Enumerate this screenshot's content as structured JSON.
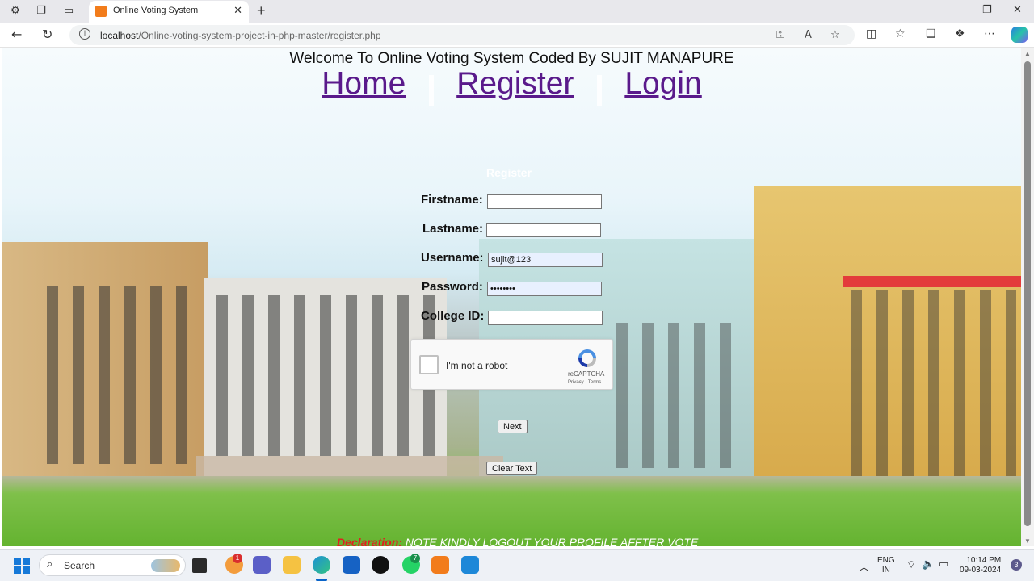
{
  "browser": {
    "tab_title": "Online Voting System",
    "url_host": "localhost",
    "url_path": "/Online-voting-system-project-in-php-master/register.php"
  },
  "page": {
    "welcome": "Welcome To Online Voting System Coded By SUJIT MANAPURE",
    "nav": {
      "home": "Home",
      "register": "Register",
      "login": "Login"
    },
    "form": {
      "title": "Register",
      "firstname_label": "Firstname:",
      "firstname_value": "",
      "lastname_label": "Lastname:",
      "lastname_value": "",
      "username_label": "Username:",
      "username_value": "sujit@123",
      "password_label": "Password:",
      "password_value": "••••••••",
      "college_label": "College ID:",
      "college_value": ""
    },
    "captcha": {
      "checkbox_label": "I'm not a robot",
      "brand": "reCAPTCHA",
      "links": "Privacy - Terms"
    },
    "buttons": {
      "next": "Next",
      "clear": "Clear Text"
    },
    "declaration": {
      "key": "Declaration:",
      "note": "NOTE KINDLY LOGOUT YOUR PROFILE AFFTER VOTE"
    }
  },
  "taskbar": {
    "search_placeholder": "Search",
    "badge_counts": {
      "app_a": "1",
      "whatsapp": "7"
    },
    "lang": "ENG",
    "region": "IN",
    "time": "10:14 PM",
    "date": "09-03-2024",
    "notifications": "3"
  },
  "colors": {
    "nav_link": "#5a1a8b",
    "declaration_key": "#e02020",
    "brand_tab": "#f27c1b"
  }
}
